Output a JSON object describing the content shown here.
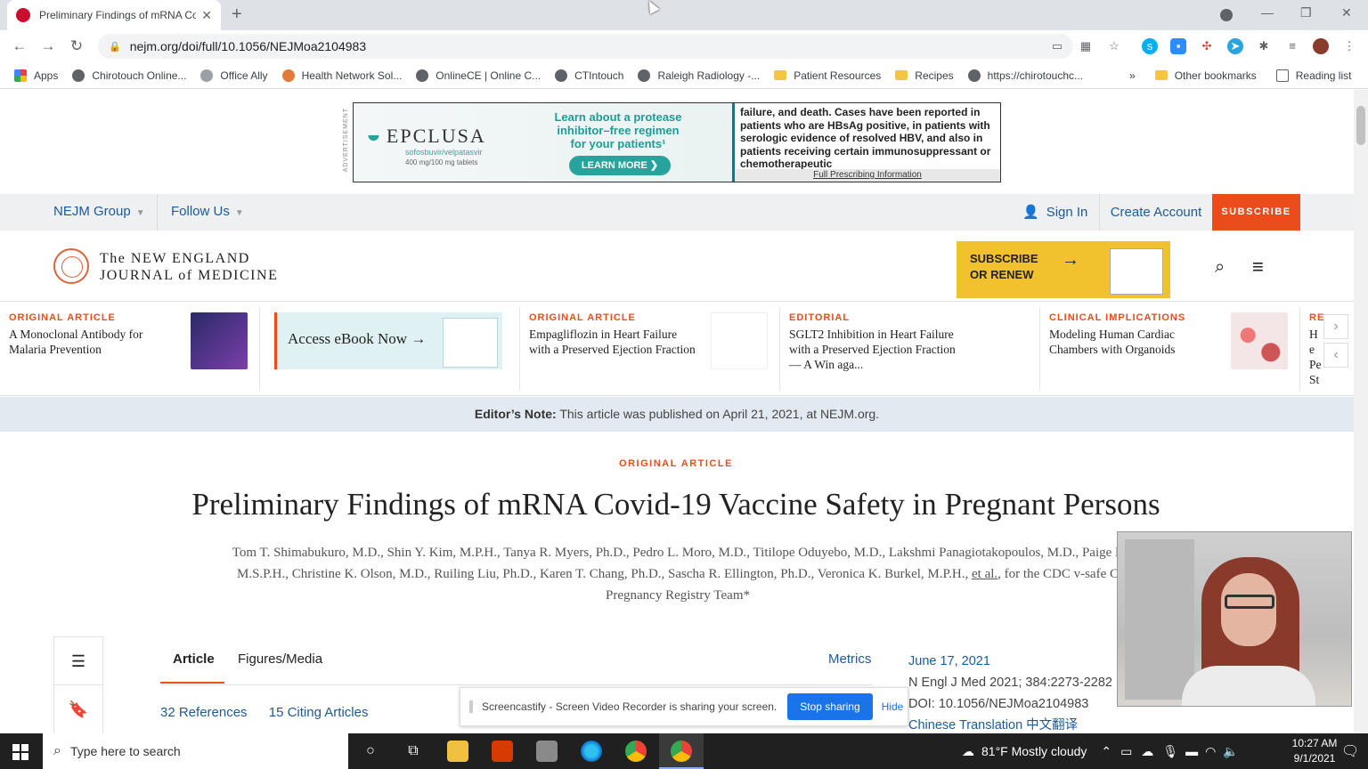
{
  "browser": {
    "tab_title": "Preliminary Findings of mRNA Co",
    "url": "nejm.org/doi/full/10.1056/NEJMoa2104983",
    "bookmarks": [
      "Apps",
      "Chirotouch Online...",
      "Office Ally",
      "Health Network Sol...",
      "OnlineCE | Online C...",
      "CTIntouch",
      "Raleigh Radiology -...",
      "Patient Resources",
      "Recipes",
      "https://chirotouchc...",
      "Other bookmarks",
      "Reading list"
    ],
    "overflow": "»"
  },
  "ad": {
    "label": "ADVERTISEMENT",
    "brand": "EPCLUSA",
    "brand_sub": "sofosbuvir/velpatasvir",
    "brand_dose": "400 mg/100 mg tablets",
    "tagline": "Learn about a protease inhibitor–free regimen for your patients¹",
    "cta": "LEARN MORE ❯",
    "isi": "failure, and death. Cases have been reported in patients who are HBsAg positive, in patients with serologic evidence of resolved HBV, and also in patients receiving certain immunosuppressant or chemotherapeutic",
    "fpi": "Full Prescribing Information"
  },
  "topbar": {
    "group": "NEJM Group",
    "follow": "Follow Us",
    "signin": "Sign In",
    "create": "Create Account",
    "subscribe": "SUBSCRIBE"
  },
  "masthead": {
    "journal_line1": "The NEW ENGLAND",
    "journal_line2": "JOURNAL of MEDICINE",
    "promo_line1": "SUBSCRIBE",
    "promo_line2": "OR RENEW"
  },
  "carousel": [
    {
      "kicker": "ORIGINAL ARTICLE",
      "headline": "A Monoclonal Antibody for Malaria Prevention"
    },
    {
      "ebook": "Access eBook Now →"
    },
    {
      "kicker": "ORIGINAL ARTICLE",
      "headline": "Empagliflozin in Heart Failure with a Preserved Ejection Fraction"
    },
    {
      "kicker": "EDITORIAL",
      "headline": "SGLT2 Inhibition in Heart Failure with a Preserved Ejection Fraction — A Win aga..."
    },
    {
      "kicker": "CLINICAL IMPLICATIONS",
      "headline": "Modeling Human Cardiac Chambers with Organoids"
    },
    {
      "kicker": "RE",
      "headline": "He Pe Sti"
    }
  ],
  "editors_note": {
    "label": "Editor’s Note:",
    "text": "This article was published on April 21, 2021, at NEJM.org."
  },
  "article": {
    "kicker": "ORIGINAL ARTICLE",
    "title": "Preliminary Findings of mRNA Covid-19 Vaccine Safety in Pregnant Persons",
    "authors_line1": "Tom T. Shimabukuro, M.D., Shin Y. Kim, M.P.H., Tanya R. Myers, Ph.D., Pedro L. Moro, M.D., Titilope Oduyebo, M.D., Lakshmi Panagiotakopoulos, M.D., Paige L",
    "authors_line2": "M.S.P.H., Christine K. Olson, M.D., Ruiling Liu, Ph.D., Karen T. Chang, Ph.D., Sascha R. Ellington, Ph.D., Veronica K. Burkel, M.P.H.,",
    "et_al": "et al.",
    "authors_line2b": ", for the CDC v-safe C",
    "authors_line3": "Pregnancy Registry Team*",
    "tabs": [
      "Article",
      "Figures/Media",
      "Metrics"
    ],
    "references": "32 References",
    "citing": "15 Citing Articles",
    "date": "June 17, 2021",
    "citation": "N Engl J Med 2021; 384:2273-2282",
    "doi": "DOI: 10.1056/NEJMoa2104983",
    "translation": "Chinese Translation 中文翻译"
  },
  "share_bar": {
    "text": "Screencastify - Screen Video Recorder is sharing your screen.",
    "stop": "Stop sharing",
    "hide": "Hide"
  },
  "taskbar": {
    "search_placeholder": "Type here to search",
    "weather": "81°F  Mostly cloudy",
    "time": "10:27 AM",
    "date": "9/1/2021"
  },
  "colors": {
    "accent": "#eb4c1c",
    "link": "#1e5a96",
    "promo": "#f2c12e"
  }
}
